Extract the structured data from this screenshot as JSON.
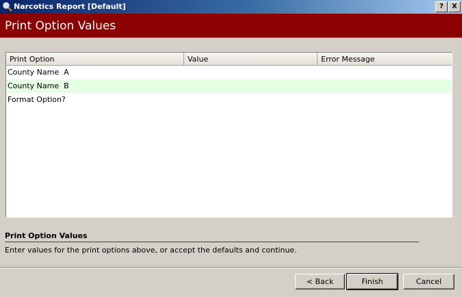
{
  "window": {
    "title": "Narcotics Report [Default]",
    "help_label": "?",
    "close_label": "X"
  },
  "banner": {
    "title": "Print Option Values",
    "color": "#8b0000"
  },
  "grid": {
    "columns": [
      "Print Option",
      "Value",
      "Error Message"
    ],
    "rows": [
      {
        "option": "County Name  A",
        "value": "",
        "error": ""
      },
      {
        "option": "County Name  B",
        "value": "",
        "error": ""
      },
      {
        "option": "Format Option?",
        "value": "",
        "error": ""
      }
    ],
    "highlight_color": "#e4ffe4"
  },
  "description": {
    "title": "Print Option Values",
    "text": "Enter values for the print options above, or accept the defaults and continue."
  },
  "buttons": {
    "back": "< Back",
    "finish": "Finish",
    "cancel": "Cancel"
  },
  "icons": {
    "title_icon": "magnifier-icon"
  }
}
